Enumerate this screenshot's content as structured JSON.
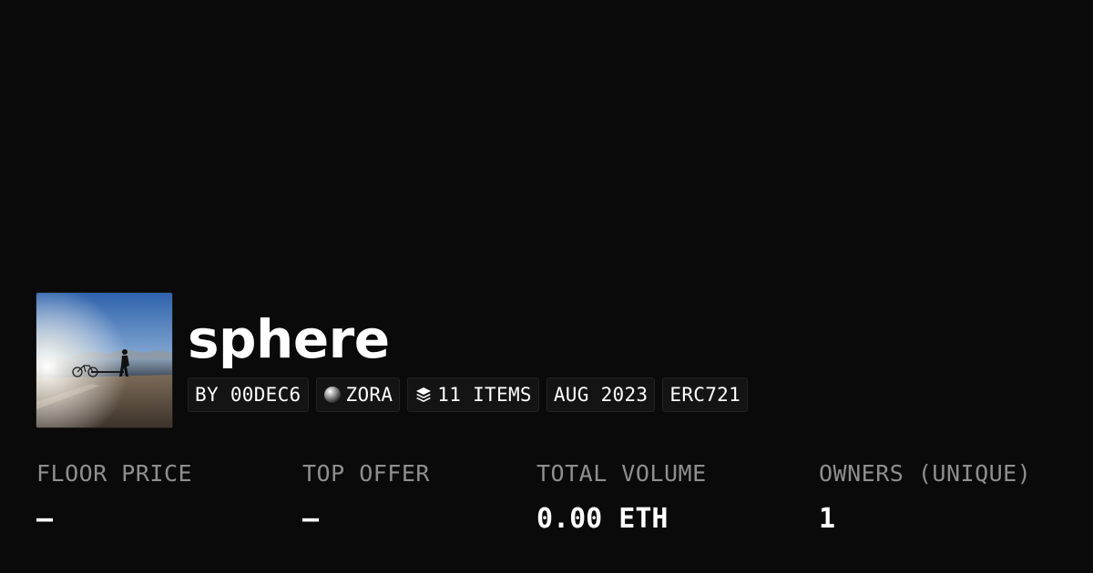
{
  "collection": {
    "name": "sphere",
    "image_alt": "silhouette of a person walking near a bicycle on a lakeshore at sunset",
    "tags": [
      {
        "icon": "",
        "label": "BY 00DEC6"
      },
      {
        "icon": "zora-orb-icon",
        "label": "ZORA"
      },
      {
        "icon": "layers-icon",
        "label": "11 ITEMS"
      },
      {
        "icon": "",
        "label": "AUG 2023"
      },
      {
        "icon": "",
        "label": "ERC721"
      }
    ]
  },
  "stats": [
    {
      "label": "FLOOR PRICE",
      "value": "–"
    },
    {
      "label": "TOP OFFER",
      "value": "–"
    },
    {
      "label": "TOTAL VOLUME",
      "value": "0.00 ETH"
    },
    {
      "label": "OWNERS (UNIQUE)",
      "value": "1"
    }
  ],
  "colors": {
    "background": "#0a0a0a",
    "tag_background": "#141414",
    "tag_border": "#222222",
    "label_gray": "#8f8f8f",
    "text": "#ffffff"
  }
}
